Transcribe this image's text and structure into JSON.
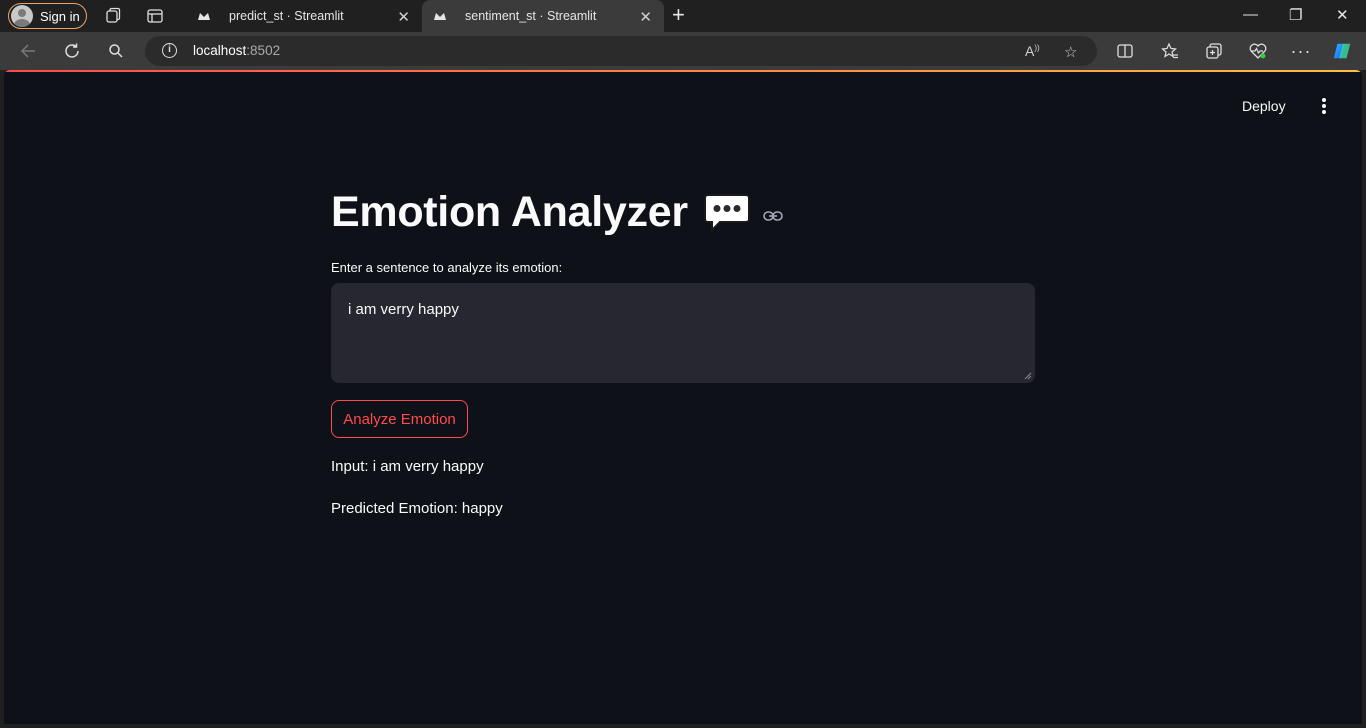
{
  "browser": {
    "sign_in": "Sign in",
    "tabs": [
      {
        "title": "predict_st · Streamlit",
        "close": "✕"
      },
      {
        "title": "sentiment_st · Streamlit",
        "close": "✕"
      }
    ],
    "new_tab": "+",
    "window": {
      "minimize": "—",
      "restore": "❐",
      "close": "✕"
    },
    "address": {
      "host": "localhost",
      "port": ":8502"
    }
  },
  "app": {
    "toolbar": {
      "deploy_label": "Deploy"
    },
    "title": "Emotion Analyzer",
    "prompt_label": "Enter a sentence to analyze its emotion:",
    "input_value": "i am verry happy",
    "button_label": "Analyze Emotion",
    "result_input": "Input: i am verry happy",
    "result_emotion": "Predicted Emotion: happy"
  },
  "colors": {
    "accent": "#ff4b4b",
    "page_background": "#0e1117",
    "input_background": "#262730",
    "text": "#fafafa"
  }
}
